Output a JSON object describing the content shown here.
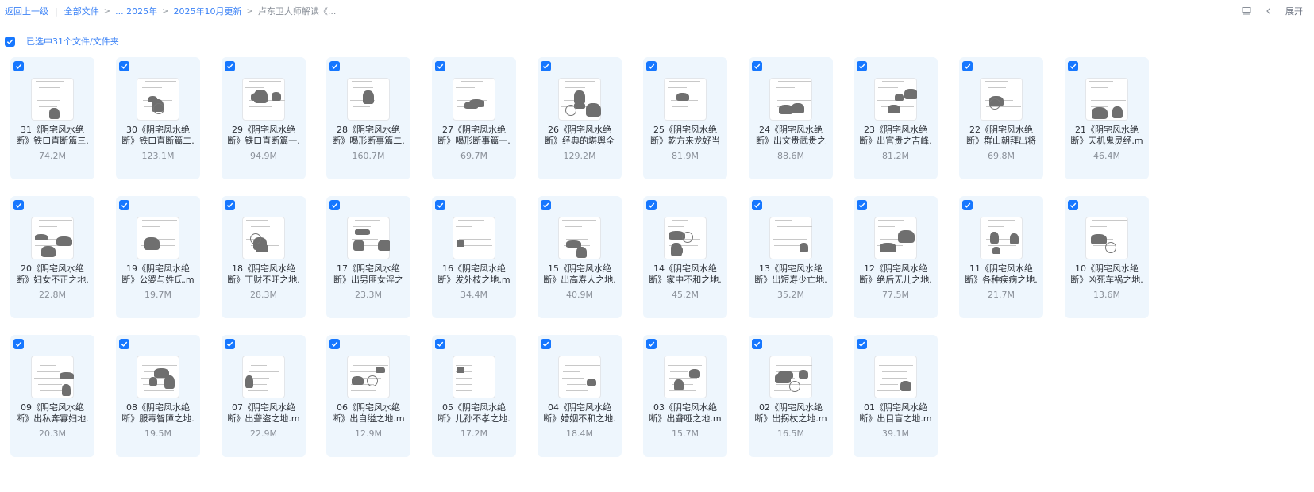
{
  "breadcrumb": {
    "back": "返回上一级",
    "root": "全部文件",
    "ellipsis_year": "... 2025年",
    "month": "2025年10月更新",
    "current": "卢东卫大师解读《..."
  },
  "toolbar": {
    "expand_label": "展开",
    "list_icon": "list-view-icon",
    "chevron_icon": "chevron-left-icon"
  },
  "selection": {
    "label": "已选中31个文件/文件夹",
    "checked": true
  },
  "colors": {
    "accent": "#1677ff",
    "card_bg": "#eef6fd",
    "muted": "#8a9099"
  },
  "files": [
    {
      "name": "31《阴宅风水绝\n断》铁口直断篇三.",
      "size": "74.2M"
    },
    {
      "name": "30《阴宅风水绝\n断》铁口直断篇二.",
      "size": "123.1M"
    },
    {
      "name": "29《阴宅风水绝\n断》铁口直断篇一.",
      "size": "94.9M"
    },
    {
      "name": "28《阴宅风水绝\n断》喝形断事篇二.",
      "size": "160.7M"
    },
    {
      "name": "27《阴宅风水绝\n断》喝形断事篇一.",
      "size": "69.7M"
    },
    {
      "name": "26《阴宅风水绝\n断》经典的堪舆全",
      "size": "129.2M"
    },
    {
      "name": "25《阴宅风水绝\n断》乾方来龙好当",
      "size": "81.9M"
    },
    {
      "name": "24《阴宅风水绝\n断》出文贵武贵之",
      "size": "88.6M"
    },
    {
      "name": "23《阴宅风水绝\n断》出官贵之吉峰.",
      "size": "81.2M"
    },
    {
      "name": "22《阴宅风水绝\n断》群山朝拜出将",
      "size": "69.8M"
    },
    {
      "name": "21《阴宅风水绝\n断》天机鬼灵经.m",
      "size": "46.4M"
    },
    {
      "name": "20《阴宅风水绝\n断》妇女不正之地.",
      "size": "22.8M"
    },
    {
      "name": "19《阴宅风水绝\n断》公婆与姓氏.m",
      "size": "19.7M"
    },
    {
      "name": "18《阴宅风水绝\n断》丁财不旺之地.",
      "size": "28.3M"
    },
    {
      "name": "17《阴宅风水绝\n断》出男匪女淫之",
      "size": "23.3M"
    },
    {
      "name": "16《阴宅风水绝\n断》发外枝之地.m",
      "size": "34.4M"
    },
    {
      "name": "15《阴宅风水绝\n断》出高寿人之地.",
      "size": "40.9M"
    },
    {
      "name": "14《阴宅风水绝\n断》家中不和之地.",
      "size": "45.2M"
    },
    {
      "name": "13《阴宅风水绝\n断》出短寿少亡地.",
      "size": "35.2M"
    },
    {
      "name": "12《阴宅风水绝\n断》绝后无儿之地.",
      "size": "77.5M"
    },
    {
      "name": "11《阴宅风水绝\n断》各种疾病之地.",
      "size": "21.7M"
    },
    {
      "name": "10《阴宅风水绝\n断》凶死车祸之地.",
      "size": "13.6M"
    },
    {
      "name": "09《阴宅风水绝\n断》出私奔寡妇地.",
      "size": "20.3M"
    },
    {
      "name": "08《阴宅风水绝\n断》服毒智障之地.",
      "size": "19.5M"
    },
    {
      "name": "07《阴宅风水绝\n断》出聋盗之地.m",
      "size": "22.9M"
    },
    {
      "name": "06《阴宅风水绝\n断》出自缢之地.m",
      "size": "12.9M"
    },
    {
      "name": "05《阴宅风水绝\n断》儿孙不孝之地.",
      "size": "17.2M"
    },
    {
      "name": "04《阴宅风水绝\n断》婚姻不和之地.",
      "size": "18.4M"
    },
    {
      "name": "03《阴宅风水绝\n断》出聋哑之地.m",
      "size": "15.7M"
    },
    {
      "name": "02《阴宅风水绝\n断》出拐杖之地.m",
      "size": "16.5M"
    },
    {
      "name": "01《阴宅风水绝\n断》出目盲之地.m",
      "size": "39.1M"
    }
  ]
}
